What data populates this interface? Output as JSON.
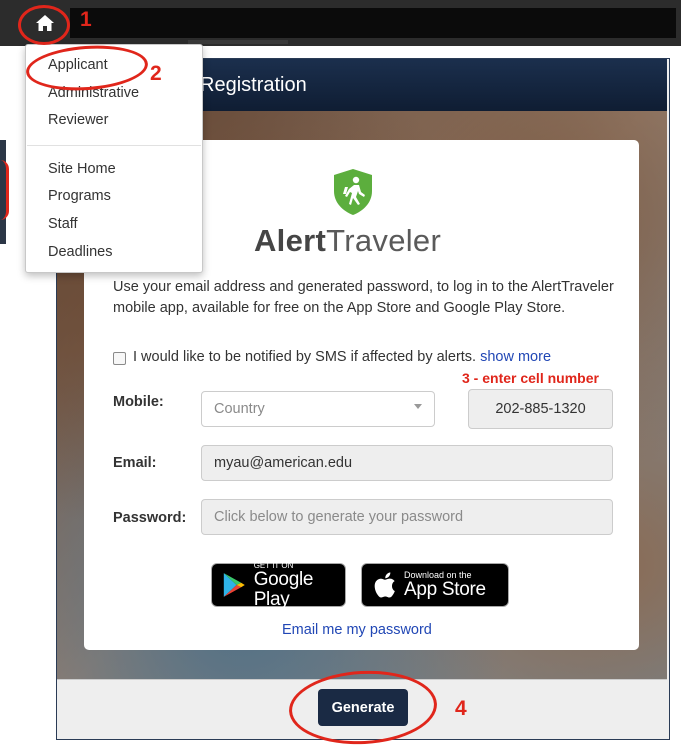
{
  "nav": {
    "home_icon": "home-icon"
  },
  "dropdown": {
    "items": [
      "Applicant",
      "Administrative",
      "Reviewer",
      "Site Home",
      "Programs",
      "Staff",
      "Deadlines"
    ]
  },
  "panel": {
    "title": "Registration"
  },
  "brand": {
    "name_bold": "Alert",
    "name_light": "Traveler",
    "logo_icon": "shield-hiker-icon",
    "logo_color": "#5cae3d"
  },
  "intro": "Use your email address and generated password, to log in to the AlertTraveler mobile app, available for free on the App Store and Google Play Store.",
  "sms": {
    "label": "I would like to be notified by SMS if affected by alerts.",
    "link": "show more",
    "checked": false
  },
  "form": {
    "mobile_label": "Mobile:",
    "country_placeholder": "Country",
    "phone_value": "202-885-1320",
    "email_label": "Email:",
    "email_value": "myau@american.edu",
    "password_label": "Password:",
    "password_placeholder": "Click below to generate your password"
  },
  "badges": {
    "google_small": "GET IT ON",
    "google_big": "Google Play",
    "apple_small": "Download on the",
    "apple_big": "App Store"
  },
  "email_link": "Email me my password",
  "generate_label": "Generate",
  "annotations": {
    "n1": "1",
    "n2": "2",
    "n3": "3 - enter cell number",
    "n4": "4",
    "color": "#e0261b"
  }
}
